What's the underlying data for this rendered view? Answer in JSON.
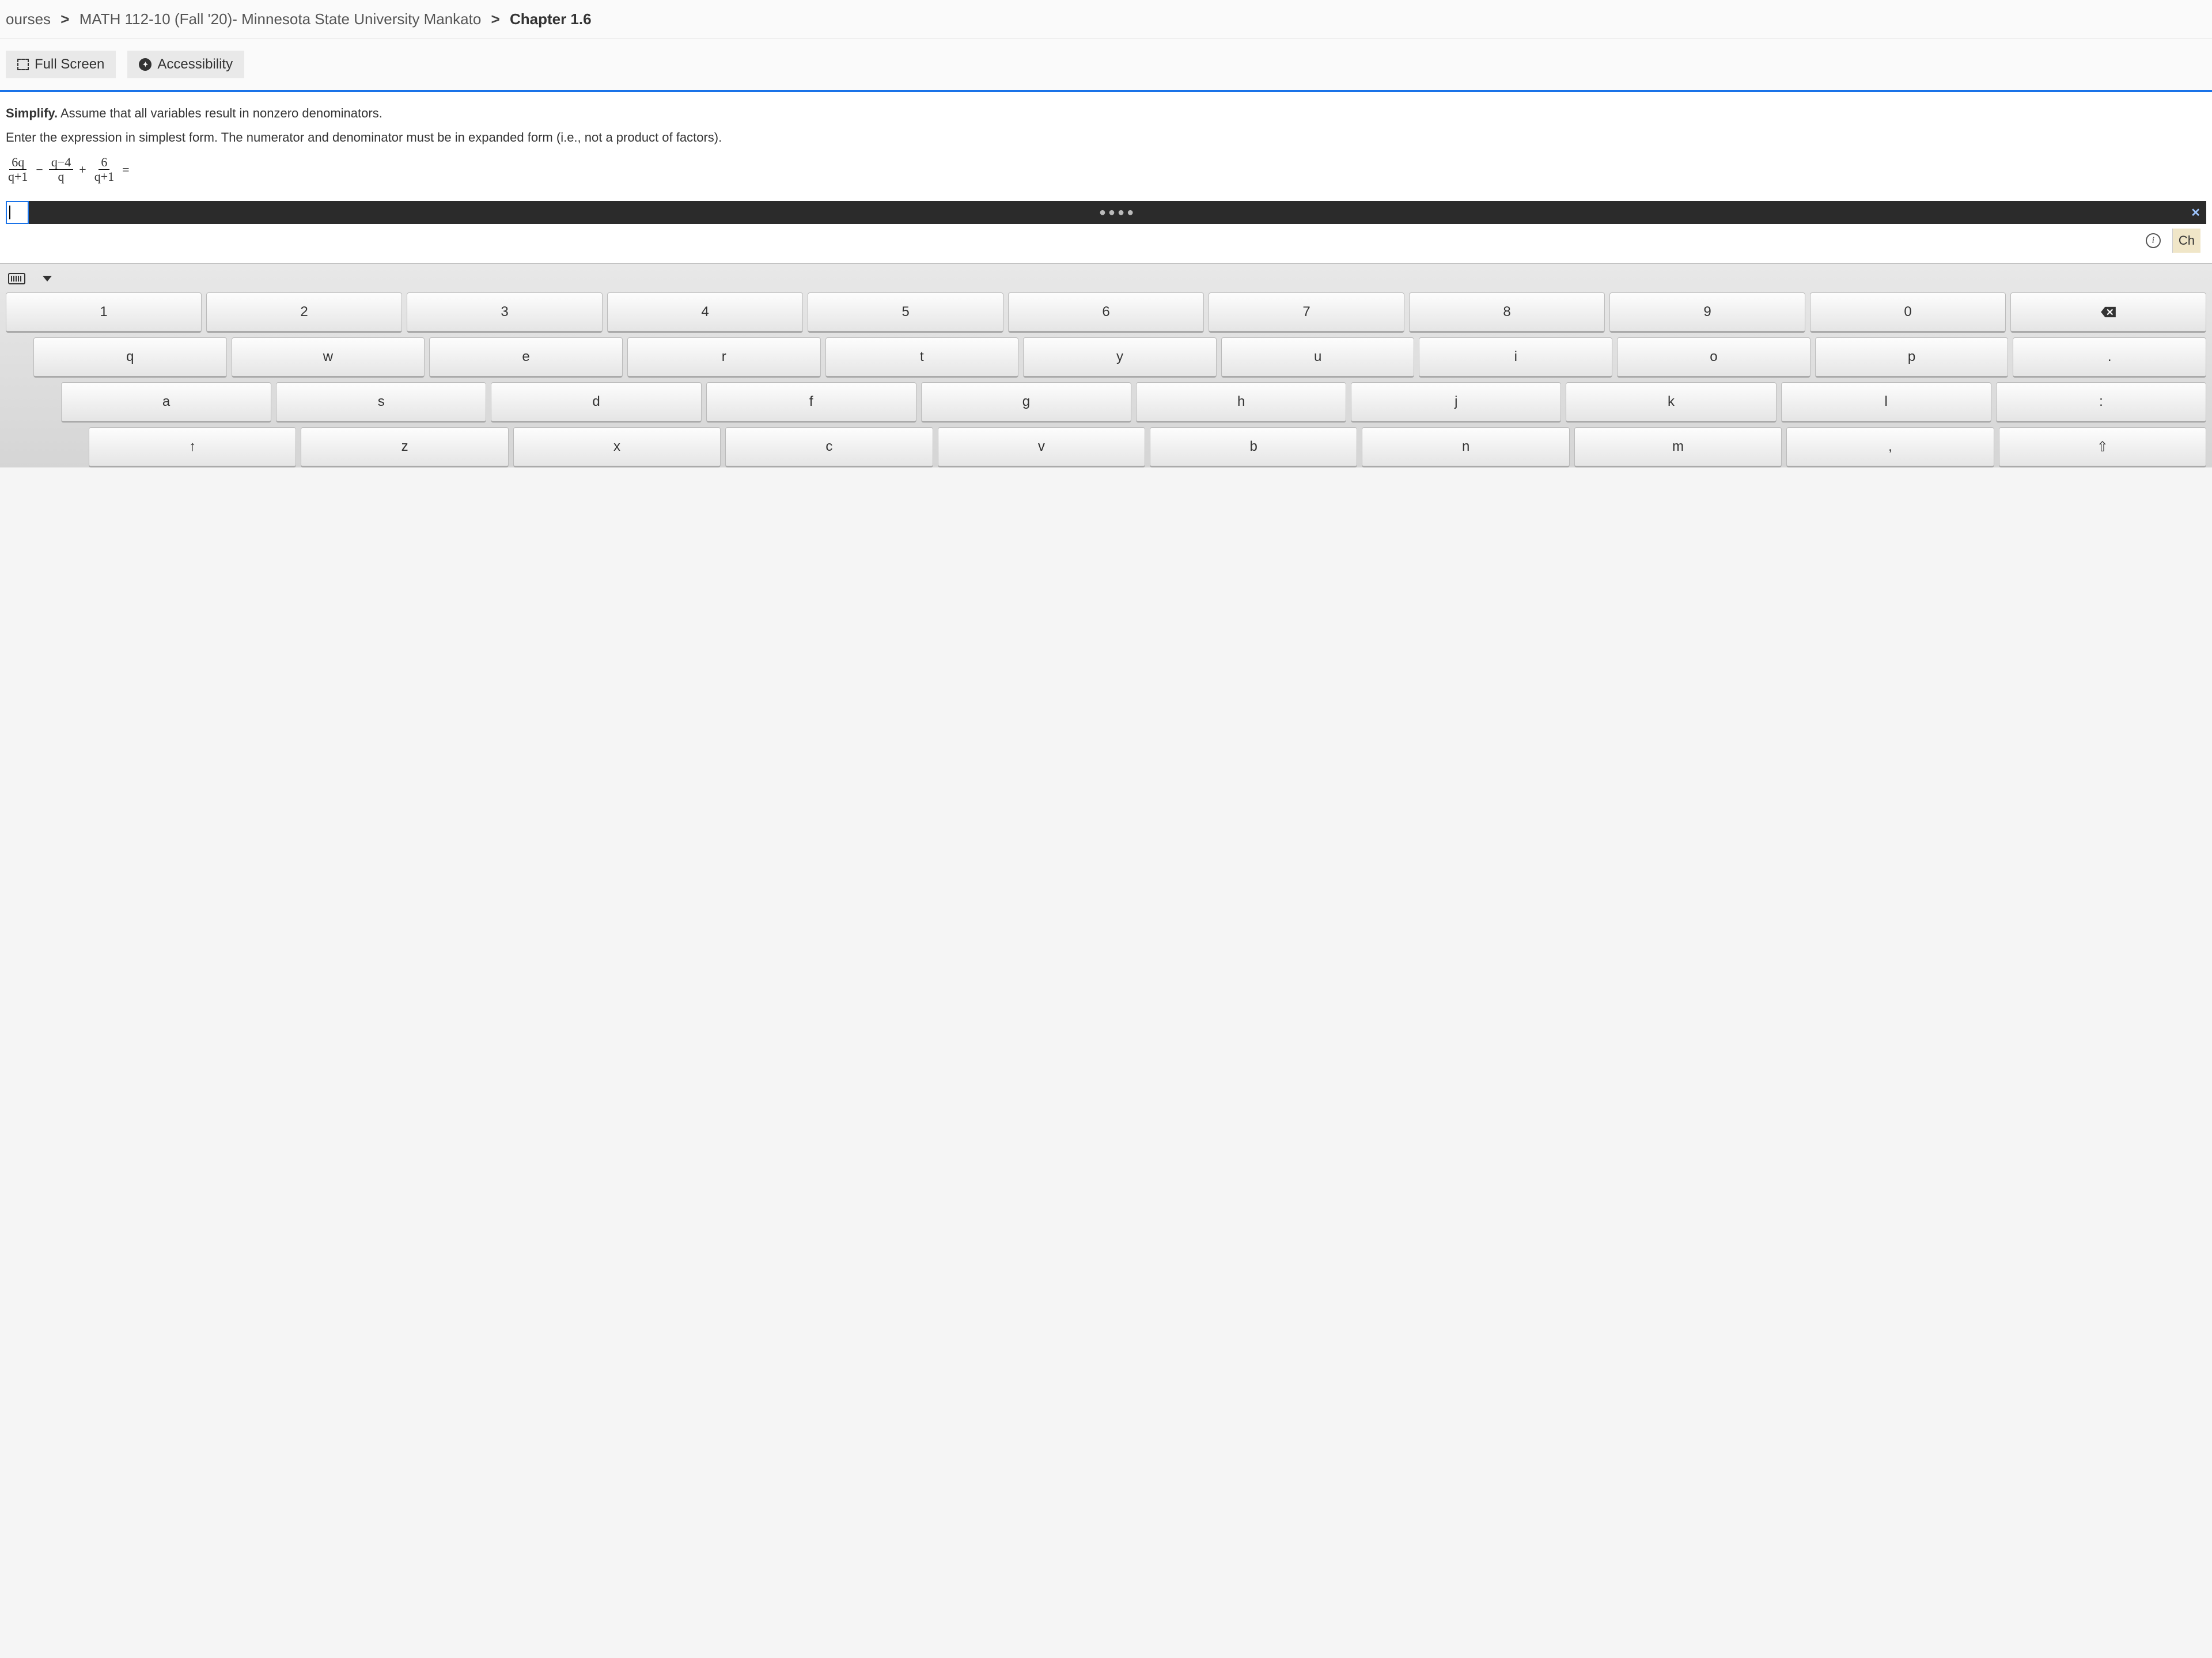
{
  "breadcrumb": {
    "level1": "ourses",
    "level2": "MATH 112-10 (Fall '20)- Minnesota State University Mankato",
    "level3": "Chapter 1.6"
  },
  "toolbar": {
    "fullscreen_label": "Full Screen",
    "accessibility_label": "Accessibility"
  },
  "question": {
    "prompt_bold": "Simplify.",
    "prompt_rest": " Assume that all variables result in nonzero denominators.",
    "instructions": "Enter the expression in simplest form. The numerator and denominator must be in expanded form (i.e., not a product of factors).",
    "expr": {
      "t1": {
        "num": "6q",
        "den": "q+1"
      },
      "op1": "−",
      "t2": {
        "num": "q−4",
        "den": "q"
      },
      "op2": "+",
      "t3": {
        "num": "6",
        "den": "q+1"
      },
      "eq": "="
    }
  },
  "answer_bar": {
    "dots": "●●●●",
    "close": "✕"
  },
  "below_bar": {
    "info": "i",
    "check_label": "Ch"
  },
  "keyboard": {
    "row1": [
      "1",
      "2",
      "3",
      "4",
      "5",
      "6",
      "7",
      "8",
      "9",
      "0"
    ],
    "row2": [
      "q",
      "w",
      "e",
      "r",
      "t",
      "y",
      "u",
      "i",
      "o",
      "p"
    ],
    "row3": [
      "a",
      "s",
      "d",
      "f",
      "g",
      "h",
      "j",
      "k",
      "l",
      ":"
    ],
    "row4_shift": "↑",
    "row4": [
      "z",
      "x",
      "c",
      "v",
      "b",
      "n",
      "m",
      ","
    ],
    "row4_shift_right": "⇧",
    "period": "."
  }
}
